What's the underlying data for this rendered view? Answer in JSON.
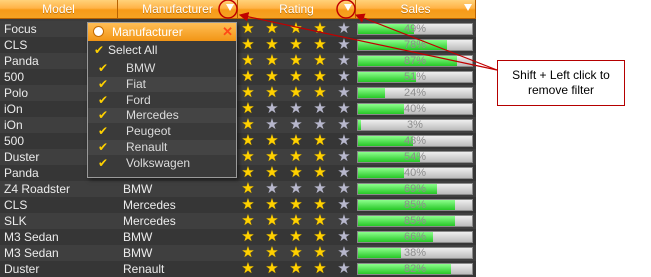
{
  "grid": {
    "columns": [
      {
        "key": "model",
        "label": "Model"
      },
      {
        "key": "manufacturer",
        "label": "Manufacturer"
      },
      {
        "key": "rating",
        "label": "Rating"
      },
      {
        "key": "sales",
        "label": "Sales"
      }
    ],
    "max_rating": 5,
    "rows": [
      {
        "model": "Focus",
        "manufacturer": "",
        "rating": 4,
        "sales": "49%",
        "sales_value": 0.49
      },
      {
        "model": "CLS",
        "manufacturer": "",
        "rating": 4,
        "sales": "78%",
        "sales_value": 0.78
      },
      {
        "model": "Panda",
        "manufacturer": "",
        "rating": 4,
        "sales": "87%",
        "sales_value": 0.87
      },
      {
        "model": "500",
        "manufacturer": "",
        "rating": 4,
        "sales": "51%",
        "sales_value": 0.51
      },
      {
        "model": "Polo",
        "manufacturer": "",
        "rating": 4,
        "sales": "24%",
        "sales_value": 0.24
      },
      {
        "model": "iOn",
        "manufacturer": "",
        "rating": 1,
        "sales": "40%",
        "sales_value": 0.4
      },
      {
        "model": "iOn",
        "manufacturer": "",
        "rating": 1,
        "sales": "3%",
        "sales_value": 0.03
      },
      {
        "model": "500",
        "manufacturer": "",
        "rating": 4,
        "sales": "48%",
        "sales_value": 0.48
      },
      {
        "model": "Duster",
        "manufacturer": "",
        "rating": 4,
        "sales": "54%",
        "sales_value": 0.54
      },
      {
        "model": "Panda",
        "manufacturer": "",
        "rating": 4,
        "sales": "40%",
        "sales_value": 0.4
      },
      {
        "model": "Z4 Roadster",
        "manufacturer": "BMW",
        "rating": 1,
        "sales": "69%",
        "sales_value": 0.69
      },
      {
        "model": "CLS",
        "manufacturer": "Mercedes",
        "rating": 4,
        "sales": "85%",
        "sales_value": 0.85
      },
      {
        "model": "SLK",
        "manufacturer": "Mercedes",
        "rating": 4,
        "sales": "85%",
        "sales_value": 0.85
      },
      {
        "model": "M3 Sedan",
        "manufacturer": "BMW",
        "rating": 4,
        "sales": "66%",
        "sales_value": 0.66
      },
      {
        "model": "M3 Sedan",
        "manufacturer": "BMW",
        "rating": 4,
        "sales": "38%",
        "sales_value": 0.38
      },
      {
        "model": "Duster",
        "manufacturer": "Renault",
        "rating": 4,
        "sales": "82%",
        "sales_value": 0.82
      }
    ]
  },
  "filter_popup": {
    "title": "Manufacturer",
    "select_all": "Select All",
    "items": [
      "BMW",
      "Fiat",
      "Ford",
      "Mercedes",
      "Peugeot",
      "Renault",
      "Volkswagen"
    ],
    "checked": [
      true,
      true,
      true,
      true,
      true,
      true,
      true
    ]
  },
  "callout": {
    "text_line1": "Shift + Left click to",
    "text_line2": "remove filter"
  },
  "colors": {
    "header": "#f5a323",
    "grid_bg": "#3b3b3b",
    "star_on": "#ffd100",
    "bar_fill": "#33cc33",
    "annotation": "#c00000"
  },
  "icons": {
    "filter": "funnel-icon",
    "star": "star-icon",
    "check": "checkmark-icon",
    "close": "close-icon"
  }
}
